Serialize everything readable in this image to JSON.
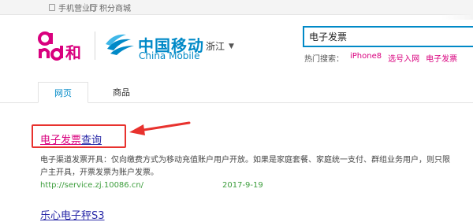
{
  "topbar": {
    "link1": "手机营业厅",
    "link2": "积分商城"
  },
  "header": {
    "brand_cn": "中国移动",
    "brand_en": "China Mobile",
    "province": "浙江",
    "logo_he_text": "and和"
  },
  "search": {
    "value": "电子发票",
    "hot_label": "热门搜索：",
    "hot_items": [
      "iPhone8",
      "选号入网",
      "电子发票"
    ]
  },
  "tabs": [
    "网页",
    "商品"
  ],
  "results": [
    {
      "title_highlight": "电子发票",
      "title_rest": "查询",
      "snippet": "电子渠道发票开具：仅向缴费方式为移动充值账户用户开放。如果是家庭套餐、家庭统一支付、群组业务用户，则只限户主开具，开票发票为账户发票。",
      "url": "http://service.zj.10086.cn/",
      "date": "2017-9-19"
    },
    {
      "title": "乐心电子秤S3"
    }
  ],
  "colors": {
    "brand_blue": "#0089c7",
    "highlight_pink": "#d9007e",
    "annotation_red": "#e8322e",
    "url_green": "#3c9d3c"
  }
}
